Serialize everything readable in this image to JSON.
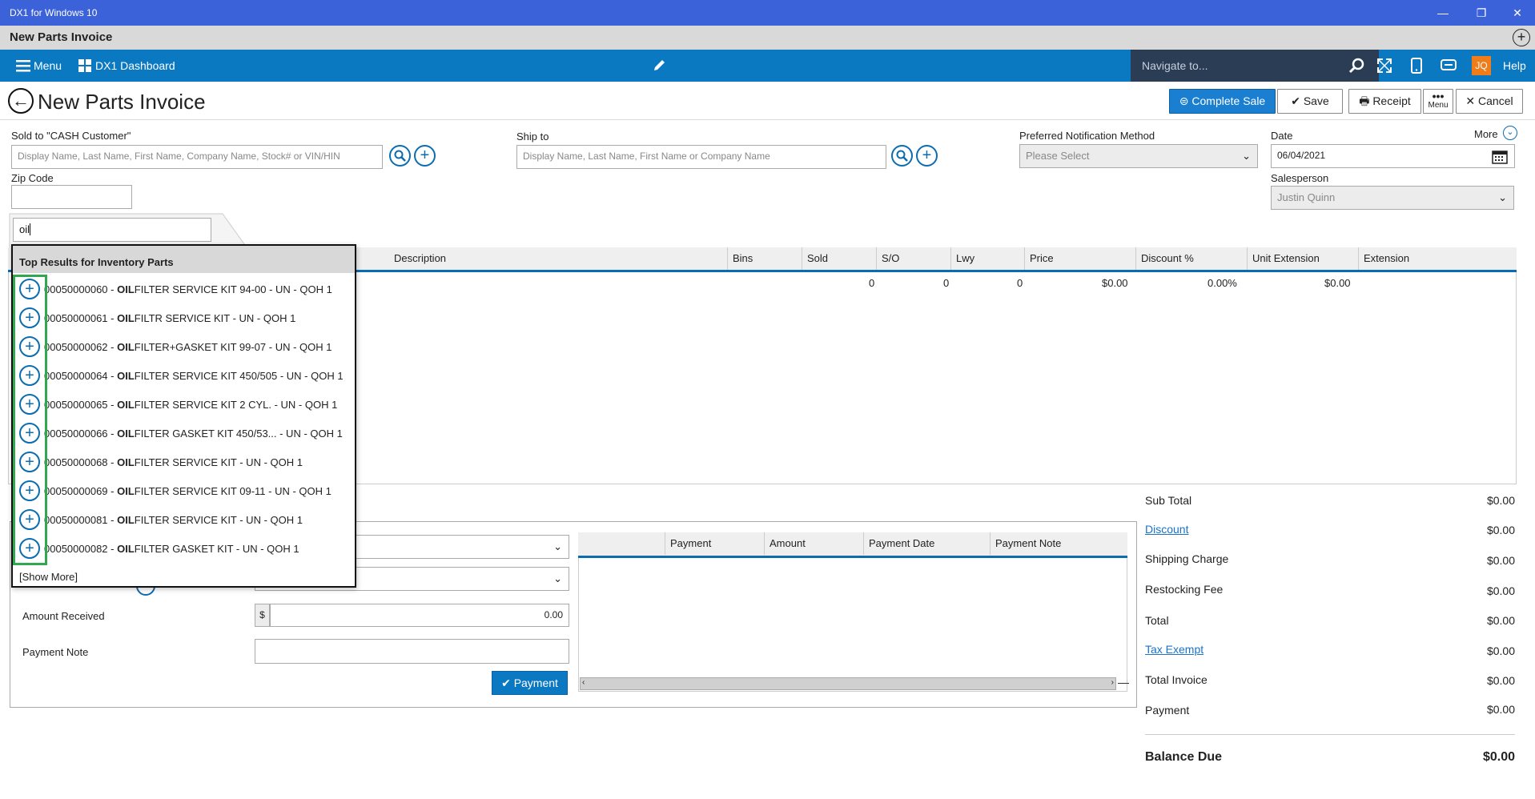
{
  "window": {
    "title": "DX1 for Windows 10",
    "minimize": "—",
    "restore": "❐",
    "close": "✕"
  },
  "subtitle": {
    "title": "New Parts Invoice",
    "add": "+"
  },
  "navbar": {
    "menu_label": "Menu",
    "dashboard_label": "DX1 Dashboard",
    "navigate_placeholder": "Navigate to...",
    "user_initials": "JQ",
    "help_label": "Help"
  },
  "header": {
    "title": "New Parts Invoice",
    "complete_sale": "Complete Sale",
    "save": "Save",
    "receipt": "Receipt",
    "menu": "Menu",
    "cancel": "Cancel"
  },
  "form": {
    "sold_to_label": "Sold to  \"CASH Customer\"",
    "sold_to_placeholder": "Display Name, Last Name, First Name, Company Name, Stock# or VIN/HIN",
    "zip_label": "Zip Code",
    "ship_to_label": "Ship to",
    "ship_to_placeholder": "Display Name, Last Name, First Name or Company Name",
    "notification_label": "Preferred Notification Method",
    "notification_value": "Please Select",
    "date_label": "Date",
    "date_value": "06/04/2021",
    "more_label": "More",
    "salesperson_label": "Salesperson",
    "salesperson_value": "Justin Quinn",
    "search_value": "oil"
  },
  "grid": {
    "columns": [
      "Description",
      "Bins",
      "Sold",
      "S/O",
      "Lwy",
      "Price",
      "Discount %",
      "Unit Extension",
      "Extension"
    ],
    "row": {
      "sold": "0",
      "so": "0",
      "lwy": "0",
      "price": "$0.00",
      "discount": "0.00%",
      "unit_ext": "$0.00"
    }
  },
  "dropdown": {
    "header": "Top Results for Inventory Parts",
    "items": [
      {
        "pre": "00050000060 - ",
        "bold": "OIL",
        "post": "FILTER SERVICE KIT 94-00 - UN - QOH 1"
      },
      {
        "pre": "00050000061 - ",
        "bold": "OIL",
        "post": "FILTR SERVICE KIT - UN - QOH 1"
      },
      {
        "pre": "00050000062 - ",
        "bold": "OIL",
        "post": "FILTER+GASKET KIT 99-07 - UN - QOH 1"
      },
      {
        "pre": "00050000064 - ",
        "bold": "OIL",
        "post": "FILTER SERVICE KIT 450/505 - UN - QOH 1"
      },
      {
        "pre": "00050000065 - ",
        "bold": "OIL",
        "post": "FILTER SERVICE KIT 2 CYL. - UN - QOH 1"
      },
      {
        "pre": "00050000066 - ",
        "bold": "OIL",
        "post": "FILTER GASKET KIT 450/53... - UN - QOH 1"
      },
      {
        "pre": "00050000068 - ",
        "bold": "OIL",
        "post": "FILTER SERVICE KIT - UN - QOH 1"
      },
      {
        "pre": "00050000069 - ",
        "bold": "OIL",
        "post": "FILTER SERVICE KIT 09-11 - UN - QOH 1"
      },
      {
        "pre": "00050000081 - ",
        "bold": "OIL",
        "post": "FILTER SERVICE KIT - UN - QOH 1"
      },
      {
        "pre": "00050000082 - ",
        "bold": "OIL",
        "post": "FILTER GASKET KIT - UN - QOH 1"
      }
    ],
    "show_more": "[Show More]"
  },
  "payment": {
    "amount_received_label": "Amount Received",
    "currency": "$",
    "amount_value": "0.00",
    "payment_note_label": "Payment Note",
    "payment_button": "Payment",
    "columns": [
      "Payment",
      "Amount",
      "Payment Date",
      "Payment Note"
    ]
  },
  "totals": {
    "sub_total_label": "Sub Total",
    "sub_total": "$0.00",
    "discount_label": "Discount",
    "discount": "$0.00",
    "shipping_label": "Shipping Charge",
    "shipping": "$0.00",
    "restocking_label": "Restocking Fee",
    "restocking": "$0.00",
    "total_label": "Total",
    "total": "$0.00",
    "tax_exempt_label": "Tax Exempt",
    "tax": "$0.00",
    "total_invoice_label": "Total Invoice",
    "total_invoice": "$0.00",
    "payment_label": "Payment",
    "payment": "$0.00",
    "balance_due_label": "Balance Due",
    "balance_due": "$0.00"
  },
  "colors": {
    "titlebar": "#3b62d9",
    "navbar": "#0b78c2",
    "accent": "#0b6db0",
    "complete_sale": "#1a7fd1",
    "highlight": "#2fa84f",
    "avatar": "#f07d1a"
  }
}
